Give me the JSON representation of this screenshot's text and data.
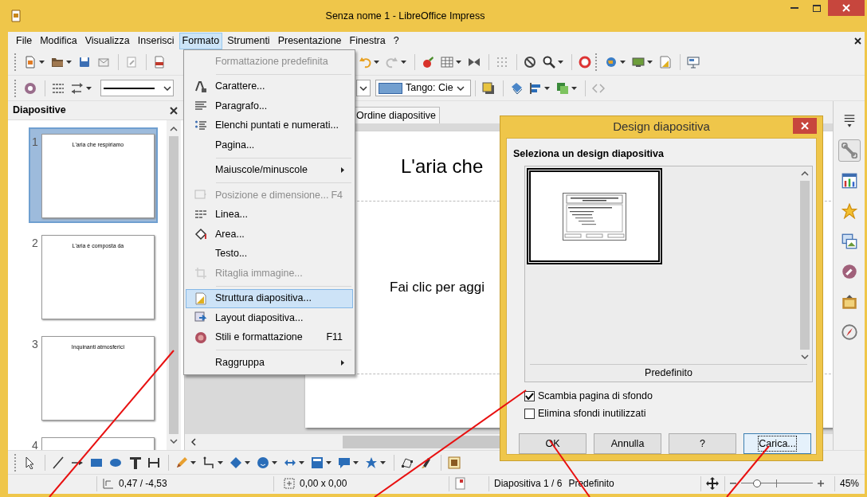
{
  "window": {
    "title": "Senza nome 1 - LibreOffice Impress"
  },
  "menubar": [
    {
      "label": "File",
      "selected": false
    },
    {
      "label": "Modifica",
      "selected": false
    },
    {
      "label": "Visualizza",
      "selected": false
    },
    {
      "label": "Inserisci",
      "selected": false
    },
    {
      "label": "Formato",
      "selected": true
    },
    {
      "label": "Strumenti",
      "selected": false
    },
    {
      "label": "Presentazione",
      "selected": false
    },
    {
      "label": "Finestra",
      "selected": false
    },
    {
      "label": "?",
      "selected": false
    }
  ],
  "format_menu": [
    {
      "kind": "item",
      "label": "Formattazione predefinita",
      "disabled": true,
      "selected": false,
      "submenu": false
    },
    {
      "kind": "separator"
    },
    {
      "kind": "item",
      "label": "Carattere...",
      "disabled": false,
      "selected": false,
      "submenu": false
    },
    {
      "kind": "item",
      "label": "Paragrafo...",
      "disabled": false,
      "selected": false,
      "submenu": false
    },
    {
      "kind": "item",
      "label": "Elenchi puntati e numerati...",
      "disabled": false,
      "selected": false,
      "submenu": false
    },
    {
      "kind": "item",
      "label": "Pagina...",
      "disabled": false,
      "selected": false,
      "submenu": false
    },
    {
      "kind": "separator"
    },
    {
      "kind": "item",
      "label": "Maiuscole/minuscole",
      "disabled": false,
      "selected": false,
      "submenu": true
    },
    {
      "kind": "separator"
    },
    {
      "kind": "item",
      "label": "Posizione e dimensione...",
      "shortcut": "F4",
      "disabled": true,
      "selected": false,
      "submenu": false
    },
    {
      "kind": "item",
      "label": "Linea...",
      "disabled": false,
      "selected": false,
      "submenu": false
    },
    {
      "kind": "item",
      "label": "Area...",
      "disabled": false,
      "selected": false,
      "submenu": false
    },
    {
      "kind": "item",
      "label": "Testo...",
      "disabled": false,
      "selected": false,
      "submenu": false
    },
    {
      "kind": "item",
      "label": "Ritaglia immagine...",
      "disabled": true,
      "selected": false,
      "submenu": false
    },
    {
      "kind": "separator"
    },
    {
      "kind": "item",
      "label": "Struttura diapositiva...",
      "disabled": false,
      "selected": true,
      "submenu": false
    },
    {
      "kind": "item",
      "label": "Layout diapositiva...",
      "disabled": false,
      "selected": false,
      "submenu": false
    },
    {
      "kind": "item",
      "label": "Stili e formattazione",
      "shortcut": "F11",
      "disabled": false,
      "selected": false,
      "submenu": false
    },
    {
      "kind": "separator"
    },
    {
      "kind": "item",
      "label": "Raggruppa",
      "disabled": false,
      "selected": false,
      "submenu": true
    }
  ],
  "color_dropdown": {
    "value": "Tango: Cie"
  },
  "slides_panel": {
    "title": "Diapositive",
    "slides": [
      {
        "number": "1",
        "title": "L'aria che respiriamo",
        "selected": true
      },
      {
        "number": "2",
        "title": "L'aria è composta da",
        "selected": false
      },
      {
        "number": "3",
        "title": "Inquinanti atmosferici",
        "selected": false
      },
      {
        "number": "4",
        "selected": false
      }
    ]
  },
  "view_tabs": [
    {
      "label": "Ordine diapositive",
      "selected": false
    }
  ],
  "slide": {
    "title": "L'aria che",
    "body": "Fai clic per aggi"
  },
  "dialog": {
    "title": "Design diapositiva",
    "heading": "Seleziona un design diapositiva",
    "designs": [
      {
        "label": "Predefinito",
        "selected": true
      }
    ],
    "options": [
      {
        "label": "Scambia pagina di sfondo",
        "checked": true
      },
      {
        "label": "Elimina sfondi inutilizzati",
        "checked": false
      }
    ],
    "buttons": [
      {
        "label": "OK",
        "focused": false
      },
      {
        "label": "Annulla",
        "focused": false
      },
      {
        "label": "?",
        "focused": false
      },
      {
        "label": "Carica...",
        "focused": true
      }
    ]
  },
  "status_bar": {
    "position": "0,47 / -4,53",
    "size": "0,00 x 0,00",
    "slide": "Diapositiva 1 / 6",
    "layout": "Predefinito",
    "zoom": {
      "level": 0.22,
      "reading": "45%"
    }
  }
}
